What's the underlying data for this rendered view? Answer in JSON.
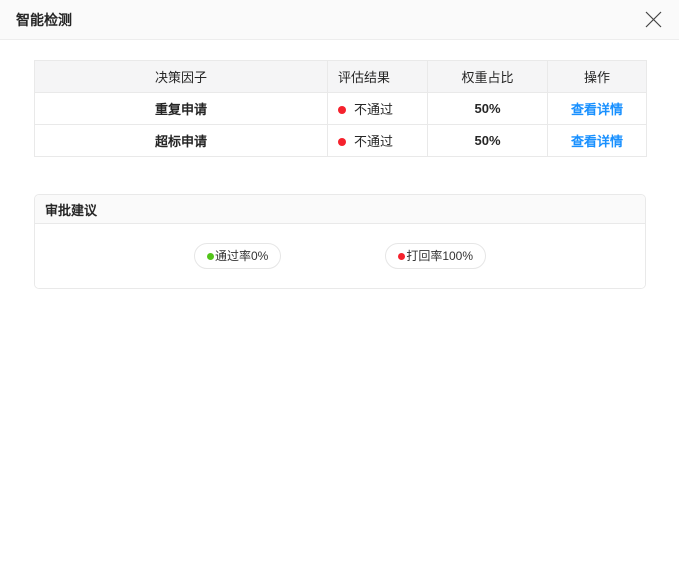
{
  "dialog": {
    "title": "智能检测",
    "close_icon": "close-icon"
  },
  "table": {
    "headers": {
      "factor": "决策因子",
      "result": "评估结果",
      "weight": "权重占比",
      "action": "操作"
    },
    "rows": [
      {
        "factor": "重复申请",
        "result": "不通过",
        "weight": "50%",
        "action": "查看详情"
      },
      {
        "factor": "超标申请",
        "result": "不通过",
        "weight": "50%",
        "action": "查看详情"
      }
    ]
  },
  "suggestion": {
    "title": "审批建议",
    "badges": [
      {
        "icon": "dot-icon",
        "label": "通过率0%",
        "dot_color_path": "pass"
      },
      {
        "icon": "dot-icon",
        "label": "打回率100%",
        "dot_color_path": "fail"
      }
    ]
  },
  "colors": {
    "fail": "#f5222d",
    "pass": "#52c41a",
    "link": "#1890ff",
    "header_bg": "#fafafa",
    "table_header_bg": "#f5f5f6",
    "border": "#e9e9e9"
  }
}
